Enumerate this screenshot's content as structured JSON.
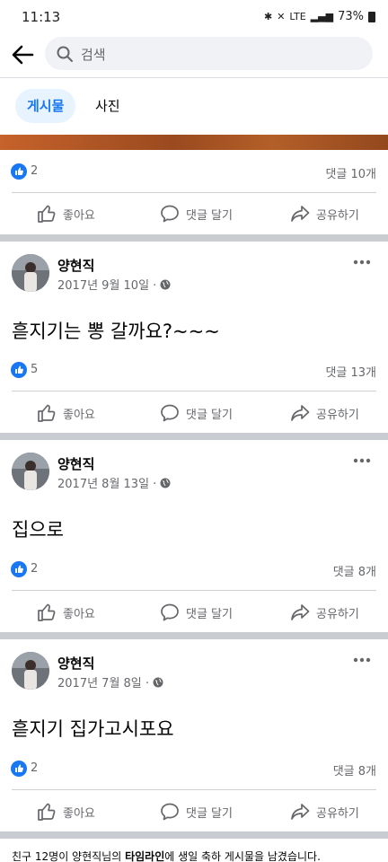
{
  "status_bar": {
    "time": "11:13",
    "battery": "73%",
    "network": "LTE"
  },
  "search": {
    "placeholder": "검색"
  },
  "tabs": [
    {
      "label": "게시물",
      "active": true
    },
    {
      "label": "사진",
      "active": false
    }
  ],
  "actions": {
    "like": "좋아요",
    "comment": "댓글 달기",
    "share": "공유하기"
  },
  "colors": {
    "accent": "#1877f2",
    "separator": "#c9ccd1",
    "muted": "#65676b"
  },
  "first_post": {
    "likes": "2",
    "comments": "댓글 10개"
  },
  "posts": [
    {
      "author": "양현직",
      "date": "2017년 9월 10일 ·",
      "text": "흗지기는 뽕 갈까요?~~~",
      "likes": "5",
      "comments": "댓글 13개"
    },
    {
      "author": "양현직",
      "date": "2017년 8월 13일 ·",
      "text": "집으로",
      "likes": "2",
      "comments": "댓글 8개"
    },
    {
      "author": "양현직",
      "date": "2017년 7월 8일 ·",
      "text": "흗지기 집가고시포요",
      "likes": "2",
      "comments": "댓글 8개"
    }
  ],
  "footer": {
    "prefix": "친구 12명이 양현직님의 ",
    "timeline": "타임라인",
    "suffix": "에 생일 축하 게시물을 남겼습니다."
  }
}
